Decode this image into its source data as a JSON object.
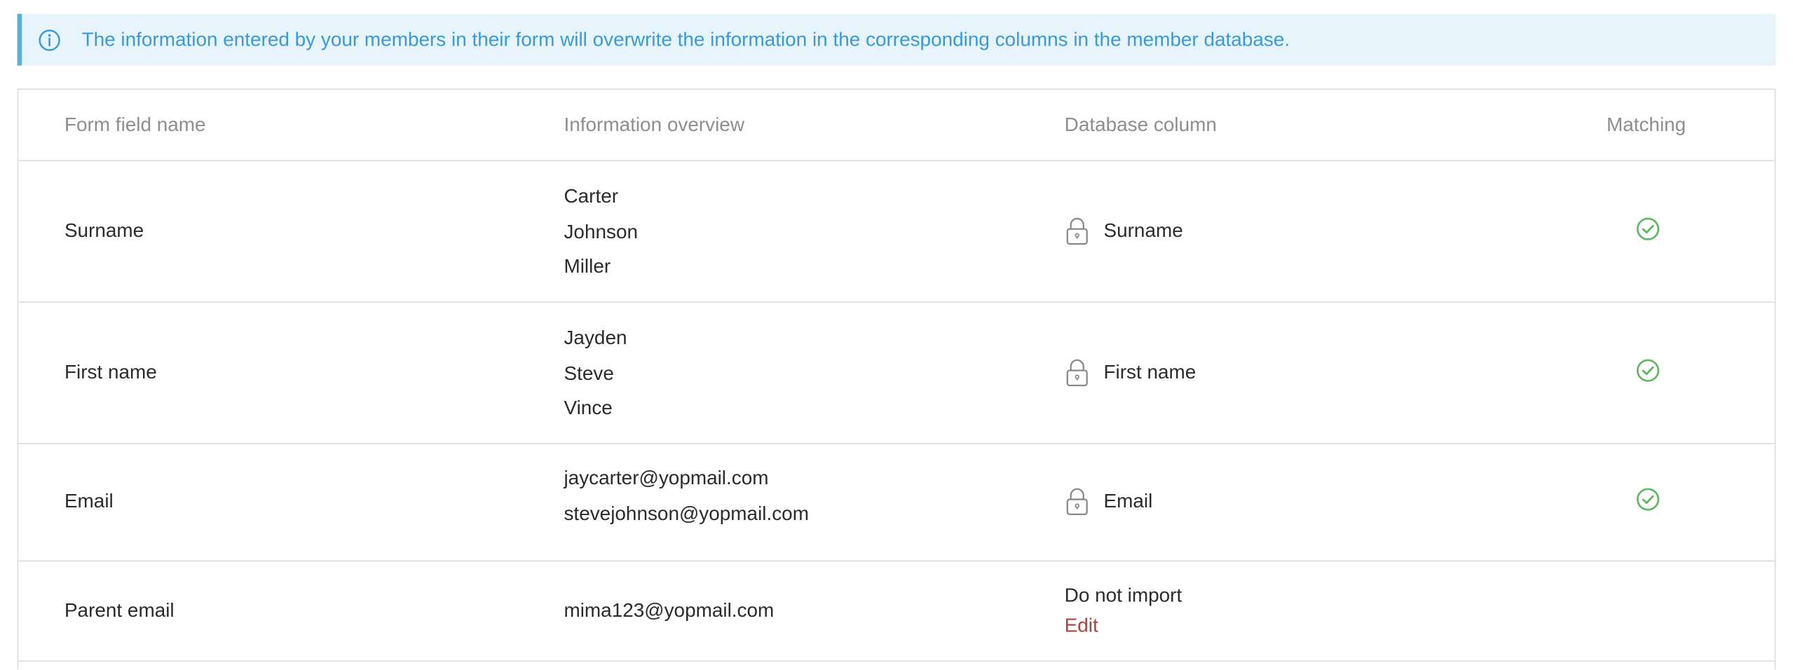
{
  "banner": {
    "text": "The information entered by your members in their form will overwrite the information in the corresponding columns in the member database.",
    "icon": "info-icon"
  },
  "table": {
    "headers": {
      "form_field": "Form field name",
      "overview": "Information overview",
      "db_column": "Database column",
      "matching": "Matching"
    },
    "rows": [
      {
        "field": "Surname",
        "values": [
          "Carter",
          "Johnson",
          "Miller"
        ],
        "db_column": "Surname",
        "locked": true,
        "matched": true
      },
      {
        "field": "First name",
        "values": [
          "Jayden",
          "Steve",
          "Vince"
        ],
        "db_column": "First name",
        "locked": true,
        "matched": true
      },
      {
        "field": "Email",
        "values": [
          "jaycarter@yopmail.com",
          "stevejohnson@yopmail.com"
        ],
        "db_column": "Email",
        "locked": true,
        "matched": true
      },
      {
        "field": "Parent email",
        "values": [
          "mima123@yopmail.com"
        ],
        "db_column": "Do not import",
        "edit_label": "Edit",
        "locked": false,
        "matched": false
      }
    ]
  },
  "colors": {
    "banner_bg": "#e7f4fb",
    "banner_accent": "#5aaee3",
    "banner_text": "#3a9ad9",
    "match_green": "#5cb85c",
    "edit_red": "#b0413e",
    "header_text": "#8e8e8e"
  }
}
